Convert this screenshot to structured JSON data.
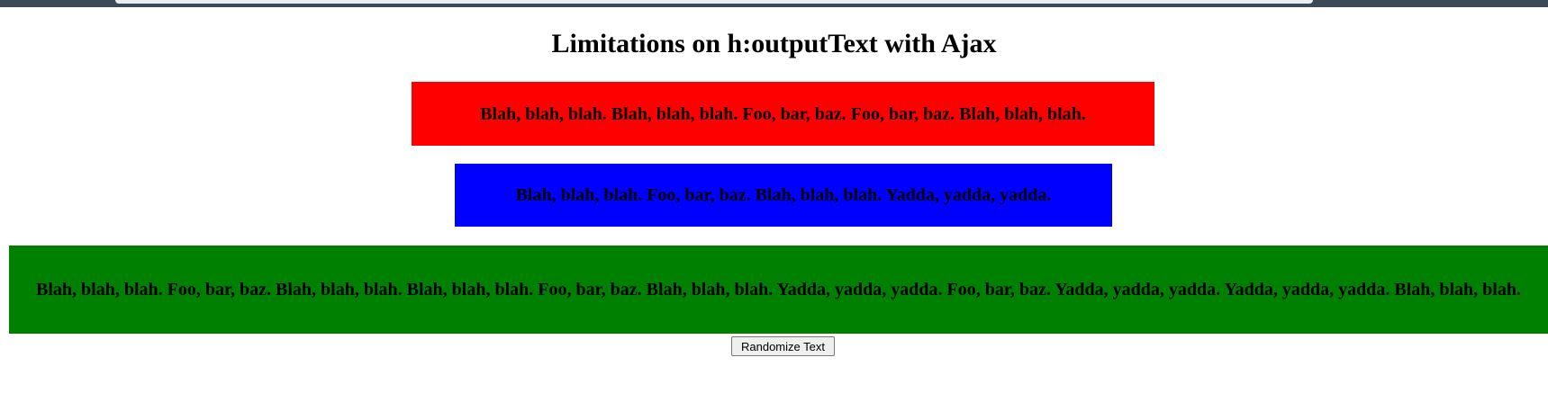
{
  "page": {
    "title": "Limitations on h:outputText with Ajax"
  },
  "blocks": [
    {
      "color": "#ff0000",
      "text": "Blah, blah, blah. Blah, blah, blah. Foo, bar, baz. Foo, bar, baz. Blah, blah, blah."
    },
    {
      "color": "#0000ff",
      "text": "Blah, blah, blah. Foo, bar, baz. Blah, blah, blah. Yadda, yadda, yadda."
    },
    {
      "color": "#008000",
      "text": "Blah, blah, blah. Foo, bar, baz. Blah, blah, blah. Blah, blah, blah. Foo, bar, baz. Blah, blah, blah. Yadda, yadda, yadda. Foo, bar, baz. Yadda, yadda, yadda. Yadda, yadda, yadda. Blah, blah, blah."
    }
  ],
  "controls": {
    "randomize_label": "Randomize Text"
  }
}
